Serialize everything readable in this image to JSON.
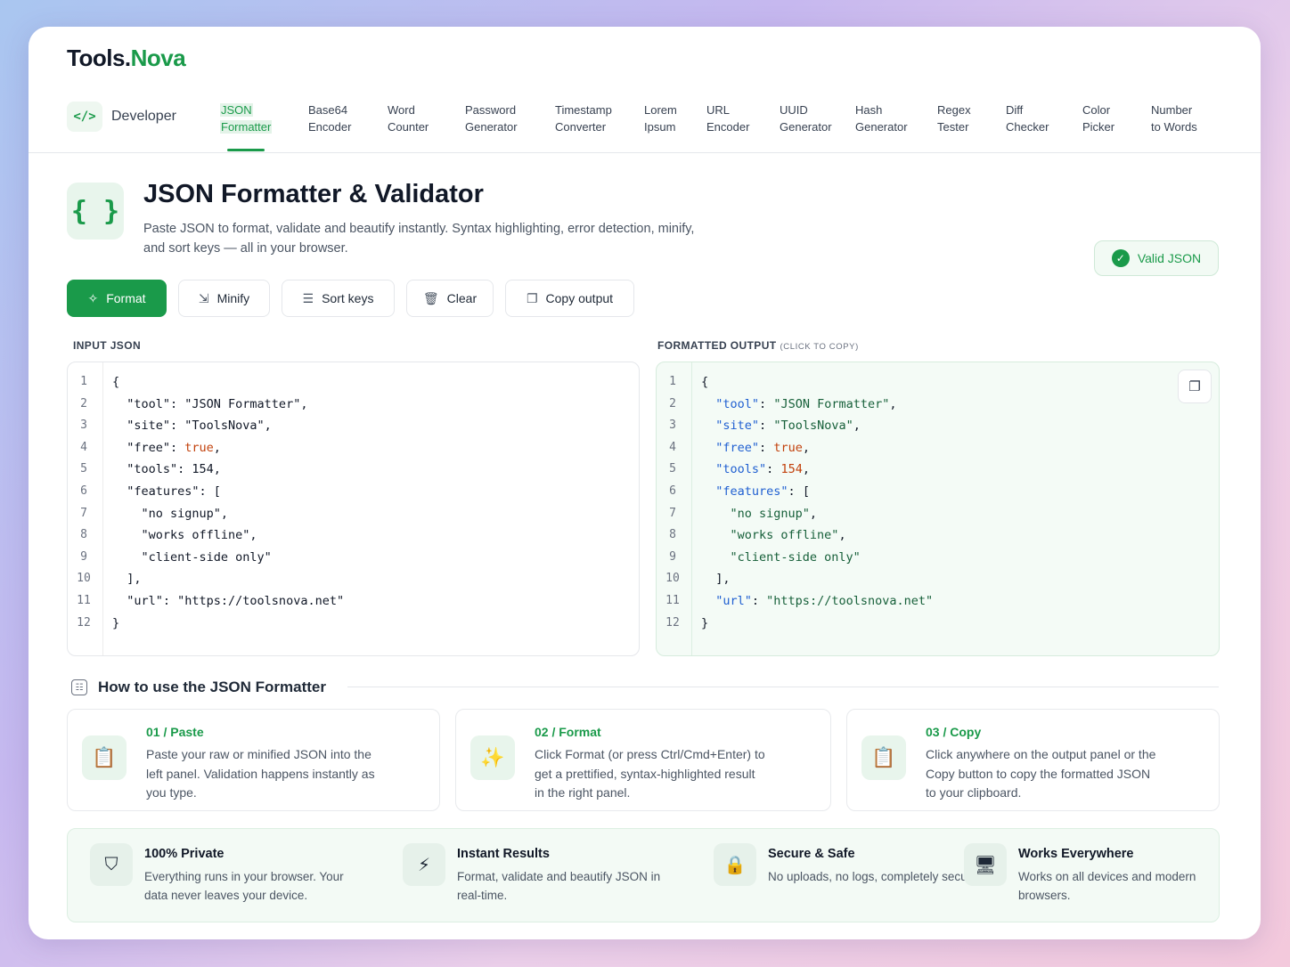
{
  "logo": {
    "part1": "Tools.",
    "part2": "Nova"
  },
  "nav": {
    "category_icon": "code-icon",
    "category_icon_glyph": "</>",
    "category_label": "Developer",
    "items": [
      {
        "line1": "JSON",
        "line2": "Formatter"
      },
      {
        "line1": "Base64",
        "line2": "Encoder"
      },
      {
        "line1": "Word",
        "line2": "Counter"
      },
      {
        "line1": "Password",
        "line2": "Generator"
      },
      {
        "line1": "Timestamp",
        "line2": "Converter"
      },
      {
        "line1": "Lorem",
        "line2": "Ipsum"
      },
      {
        "line1": "URL",
        "line2": "Encoder"
      },
      {
        "line1": "UUID",
        "line2": "Generator"
      },
      {
        "line1": "Hash",
        "line2": "Generator"
      },
      {
        "line1": "Regex",
        "line2": "Tester"
      },
      {
        "line1": "Diff",
        "line2": "Checker"
      },
      {
        "line1": "Color",
        "line2": "Picker"
      },
      {
        "line1": "Number",
        "line2": "to Words"
      }
    ]
  },
  "tool": {
    "icon_glyph": "{ }",
    "title": "JSON Formatter & Validator",
    "description": "Paste JSON to format, validate and beautify instantly. Syntax highlighting, error detection, minify, and sort keys — all in your browser.",
    "status": "Valid JSON"
  },
  "toolbar": {
    "format": "Format",
    "minify": "Minify",
    "sort": "Sort keys",
    "clear": "Clear",
    "copy": "Copy output"
  },
  "input": {
    "label": "INPUT JSON",
    "lines": [
      "{",
      "  \"tool\": \"JSON Formatter\",",
      "  \"site\": \"ToolsNova\",",
      "  \"free\": true,",
      "  \"tools\": 154,",
      "  \"features\": [",
      "    \"no signup\",",
      "    \"works offline\",",
      "    \"client-side only\"",
      "  ],",
      "  \"url\": \"https://toolsnova.net\"",
      "}"
    ]
  },
  "output": {
    "label": "FORMATTED OUTPUT",
    "label_hint": "(CLICK TO COPY)",
    "lines": [
      "{",
      "  \"tool\": \"JSON Formatter\",",
      "  \"site\": \"ToolsNova\",",
      "  \"free\": true,",
      "  \"tools\": 154,",
      "  \"features\": [",
      "    \"no signup\",",
      "    \"works offline\",",
      "    \"client-side only\"",
      "  ],",
      "  \"url\": \"https://toolsnova.net\"",
      "}"
    ]
  },
  "howto": {
    "title": "How to use the JSON Formatter",
    "steps": [
      {
        "num": "01 / Paste",
        "icon": "clipboard-icon",
        "text": "Paste your raw or minified JSON into the left panel. Validation happens instantly as you type."
      },
      {
        "num": "02 / Format",
        "icon": "magic-wand-icon",
        "text": "Click Format (or press Ctrl/Cmd+Enter) to get a prettified, syntax-highlighted result in the right panel."
      },
      {
        "num": "03 / Copy",
        "icon": "clipboard-icon",
        "text": "Click anywhere on the output panel or the Copy button to copy the formatted JSON to your clipboard."
      }
    ]
  },
  "features": [
    {
      "title": "100% Private",
      "icon": "shield-icon",
      "text": "Everything runs in your browser. Your data never leaves your device."
    },
    {
      "title": "Instant Results",
      "icon": "lightning-icon",
      "text": "Format, validate and beautify JSON in real-time."
    },
    {
      "title": "Secure & Safe",
      "icon": "lock-icon",
      "text": "No uploads, no logs, completely secure."
    },
    {
      "title": "Works Everywhere",
      "icon": "devices-icon",
      "text": "Works on all devices and modern browsers."
    }
  ],
  "colors": {
    "accent": "#1a9a4a",
    "key": "#1f5fd1",
    "string": "#17603a",
    "literal": "#c2410c"
  }
}
